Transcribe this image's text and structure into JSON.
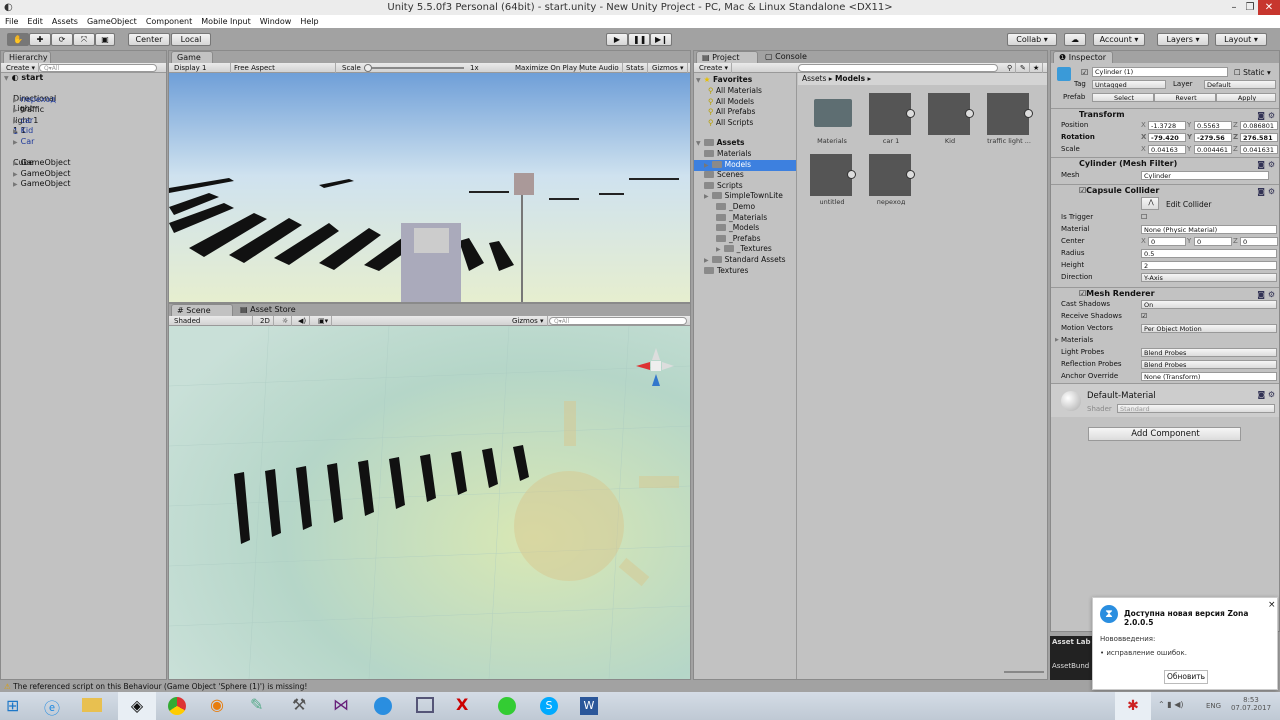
{
  "window": {
    "title": "Unity 5.5.0f3 Personal (64bit) - start.unity - New Unity Project - PC, Mac & Linux Standalone <DX11>",
    "minimize": "–",
    "maximize": "❐",
    "close": "✕"
  },
  "menu": [
    "File",
    "Edit",
    "Assets",
    "GameObject",
    "Component",
    "Mobile Input",
    "Window",
    "Help"
  ],
  "toolbar": {
    "center": "Center",
    "local": "Local",
    "collab": "Collab ▾",
    "account": "Account ▾",
    "layers": "Layers ▾",
    "layout": "Layout ▾"
  },
  "hierarchy": {
    "tab": "Hierarchy",
    "create": "Create ▾",
    "search_placeholder": "Q▾All",
    "scene": "start",
    "items": [
      {
        "label": "Directional Light",
        "arrow": false,
        "prefab": false
      },
      {
        "label": "переход",
        "arrow": true,
        "prefab": true
      },
      {
        "label": "traffic light 1 1 1",
        "arrow": true,
        "prefab": false
      },
      {
        "label": "car 1",
        "arrow": true,
        "prefab": true
      },
      {
        "label": "Kid",
        "arrow": true,
        "prefab": true
      },
      {
        "label": "Car",
        "arrow": true,
        "prefab": true
      },
      {
        "label": "Cube",
        "arrow": false,
        "prefab": false
      },
      {
        "label": "GameObject",
        "arrow": true,
        "prefab": false
      },
      {
        "label": "GameObject",
        "arrow": true,
        "prefab": false
      },
      {
        "label": "GameObject",
        "arrow": true,
        "prefab": false
      }
    ]
  },
  "game": {
    "tab": "Game",
    "display": "Display 1",
    "aspect": "Free Aspect",
    "scale_label": "Scale",
    "scale_value": "1x",
    "scale_fraction": 0,
    "maximize": "Maximize On Play",
    "mute": "Mute Audio",
    "stats": "Stats",
    "gizmos": "Gizmos ▾"
  },
  "scene": {
    "tab": "Scene",
    "asset_store_tab": "Asset Store",
    "shaded": "Shaded",
    "mode2d": "2D",
    "gizmos": "Gizmos ▾",
    "search_placeholder": "Q▾All"
  },
  "project": {
    "tab": "Project",
    "console_tab": "Console",
    "create": "Create ▾",
    "breadcrumb": [
      "Assets",
      "Models"
    ],
    "favorites": {
      "label": "Favorites",
      "items": [
        "All Materials",
        "All Models",
        "All Prefabs",
        "All Scripts"
      ]
    },
    "assets_label": "Assets",
    "tree": [
      {
        "label": "Materials",
        "indent": 1,
        "arrow": false,
        "selected": false
      },
      {
        "label": "Models",
        "indent": 1,
        "arrow": true,
        "selected": true
      },
      {
        "label": "Scenes",
        "indent": 1,
        "arrow": false,
        "selected": false
      },
      {
        "label": "Scripts",
        "indent": 1,
        "arrow": false,
        "selected": false
      },
      {
        "label": "SimpleTownLite",
        "indent": 1,
        "arrow": true,
        "selected": false
      },
      {
        "label": "_Demo",
        "indent": 2,
        "arrow": false,
        "selected": false
      },
      {
        "label": "_Materials",
        "indent": 2,
        "arrow": false,
        "selected": false
      },
      {
        "label": "_Models",
        "indent": 2,
        "arrow": false,
        "selected": false
      },
      {
        "label": "_Prefabs",
        "indent": 2,
        "arrow": false,
        "selected": false
      },
      {
        "label": "_Textures",
        "indent": 2,
        "arrow": true,
        "selected": false
      },
      {
        "label": "Standard Assets",
        "indent": 1,
        "arrow": true,
        "selected": false
      },
      {
        "label": "Textures",
        "indent": 1,
        "arrow": false,
        "selected": false
      }
    ],
    "grid": [
      "Materials",
      "car 1",
      "Kid",
      "traffic light ...",
      "untitled",
      "переход"
    ]
  },
  "inspector": {
    "tab": "Inspector",
    "name": "Cylinder (1)",
    "static": "Static",
    "tag_label": "Tag",
    "tag": "Untagged",
    "layer_label": "Layer",
    "layer": "Default",
    "prefab_label": "Prefab",
    "select": "Select",
    "revert": "Revert",
    "apply": "Apply",
    "transform": {
      "title": "Transform",
      "position": {
        "label": "Position",
        "x": "-1.3728",
        "y": "0.5563",
        "z": "0.086801"
      },
      "rotation": {
        "label": "Rotation",
        "x": "-79.420",
        "y": "-279.56",
        "z": "276.581"
      },
      "scale": {
        "label": "Scale",
        "x": "0.04163",
        "y": "0.004461",
        "z": "0.041631"
      }
    },
    "mesh_filter": {
      "title": "Cylinder (Mesh Filter)",
      "mesh_label": "Mesh",
      "mesh": "Cylinder"
    },
    "capsule": {
      "title": "Capsule Collider",
      "edit": "Edit Collider",
      "is_trigger": "Is Trigger",
      "material_label": "Material",
      "material": "None (Physic Material)",
      "center_label": "Center",
      "cx": "0",
      "cy": "0",
      "cz": "0",
      "radius_label": "Radius",
      "radius": "0.5",
      "height_label": "Height",
      "height": "2",
      "direction_label": "Direction",
      "direction": "Y-Axis"
    },
    "renderer": {
      "title": "Mesh Renderer",
      "cast_label": "Cast Shadows",
      "cast": "On",
      "receive_label": "Receive Shadows",
      "motion_label": "Motion Vectors",
      "motion": "Per Object Motion",
      "materials": "Materials",
      "light_label": "Light Probes",
      "light": "Blend Probes",
      "refl_label": "Reflection Probes",
      "refl": "Blend Probes",
      "anchor_label": "Anchor Override",
      "anchor": "None (Transform)"
    },
    "material": {
      "name": "Default-Material",
      "shader_label": "Shader",
      "shader": "Standard"
    },
    "add_component": "Add Component"
  },
  "asset_labels": {
    "title": "Asset Lab",
    "bundle": "AssetBund"
  },
  "status": {
    "message": "The referenced script on this Behaviour (Game Object 'Sphere (1)') is missing!"
  },
  "notification": {
    "title": "Доступна новая версия Zona 2.0.0.5",
    "subtitle": "Нововведения:",
    "bullet": "исправление ошибок.",
    "button": "Обновить",
    "close": "×"
  },
  "taskbar": {
    "lang": "ENG",
    "time": "8:53",
    "date": "07.07.2017"
  }
}
